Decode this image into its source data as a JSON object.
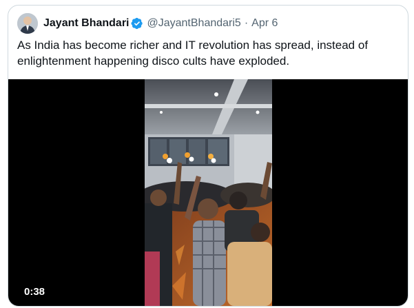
{
  "tweet": {
    "author_name": "Jayant Bhandari",
    "handle": "@JayantBhandari5",
    "separator": "·",
    "date": "Apr 6",
    "verified": true,
    "text_line1": "As India has become richer and IT revolution has spread, instead of",
    "text_line2": "enlightenment happening disco cults have exploded."
  },
  "media": {
    "type": "video",
    "duration": "0:38"
  },
  "colors": {
    "text": "#0f1419",
    "secondary": "#536471",
    "verified_badge": "#1d9bf0",
    "border": "#cfd9de"
  },
  "icons": {
    "verified": "verified-badge-icon"
  }
}
